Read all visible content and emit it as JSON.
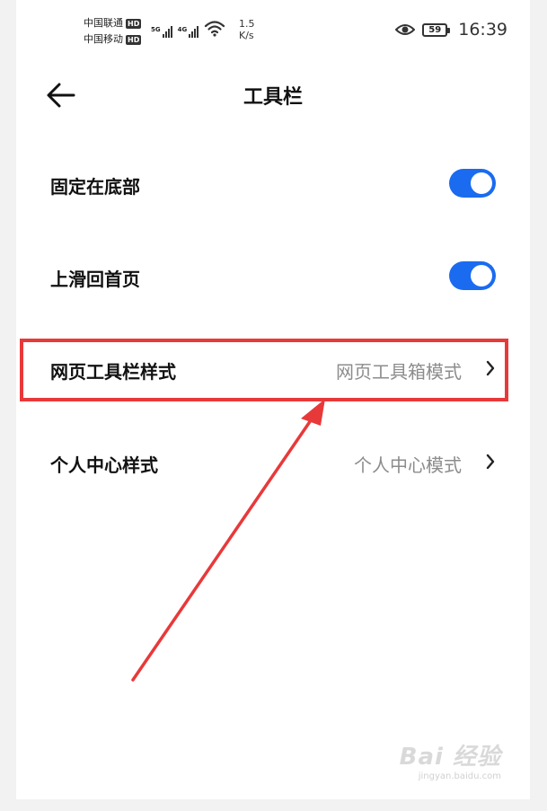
{
  "status_bar": {
    "carrier1": "中国联通",
    "carrier2": "中国移动",
    "hd_label": "HD",
    "sig1_type": "5G",
    "sig2_type": "4G",
    "speed_value": "1.5",
    "speed_unit": "K/s",
    "battery": "59",
    "time": "16:39"
  },
  "header": {
    "title": "工具栏",
    "back_icon": "arrow-left-icon"
  },
  "settings": {
    "fixed_bottom": {
      "label": "固定在底部",
      "toggle_on": true
    },
    "swipe_home": {
      "label": "上滑回首页",
      "toggle_on": true
    },
    "web_toolbar_style": {
      "label": "网页工具栏样式",
      "value": "网页工具箱模式"
    },
    "personal_center_style": {
      "label": "个人中心样式",
      "value": "个人中心模式"
    }
  },
  "annotation": {
    "highlight_color": "#e8393a",
    "arrow_color": "#e8393a"
  },
  "colors": {
    "toggle_on": "#1a6bf0",
    "value_text": "#8c8c8c"
  },
  "watermark": {
    "main": "Bai 经验",
    "sub": "jingyan.baidu.com"
  }
}
